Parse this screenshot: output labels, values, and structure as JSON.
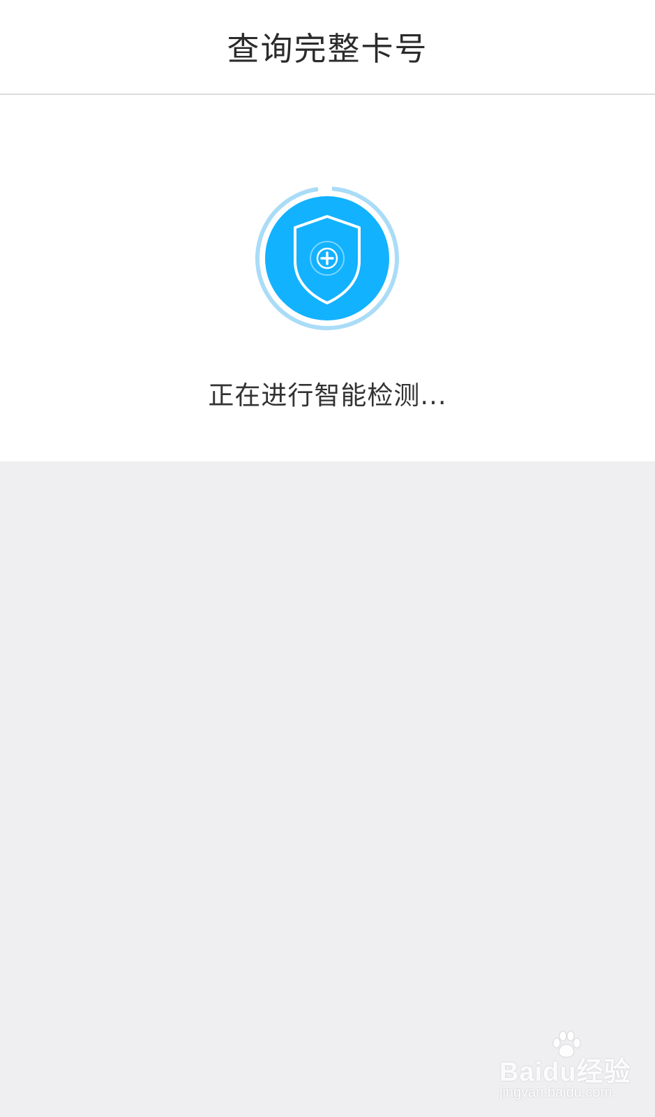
{
  "header": {
    "title": "查询完整卡号"
  },
  "detection": {
    "status_text": "正在进行智能检测...",
    "icon": "shield-plus-icon",
    "colors": {
      "accent": "#12b2ff",
      "ring": "#a9dcf7"
    }
  },
  "watermark": {
    "brand": "Baidu经验",
    "url": "jingyan.baidu.com",
    "icon": "paw-icon"
  },
  "colors": {
    "background": "#efeef1",
    "card": "#ffffff"
  }
}
